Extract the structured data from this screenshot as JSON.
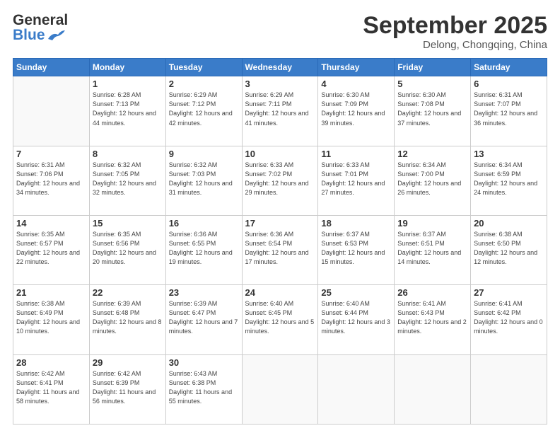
{
  "header": {
    "logo_general": "General",
    "logo_blue": "Blue",
    "month_title": "September 2025",
    "subtitle": "Delong, Chongqing, China"
  },
  "weekdays": [
    "Sunday",
    "Monday",
    "Tuesday",
    "Wednesday",
    "Thursday",
    "Friday",
    "Saturday"
  ],
  "weeks": [
    [
      {
        "day": "",
        "sunrise": "",
        "sunset": "",
        "daylight": ""
      },
      {
        "day": "1",
        "sunrise": "Sunrise: 6:28 AM",
        "sunset": "Sunset: 7:13 PM",
        "daylight": "Daylight: 12 hours and 44 minutes."
      },
      {
        "day": "2",
        "sunrise": "Sunrise: 6:29 AM",
        "sunset": "Sunset: 7:12 PM",
        "daylight": "Daylight: 12 hours and 42 minutes."
      },
      {
        "day": "3",
        "sunrise": "Sunrise: 6:29 AM",
        "sunset": "Sunset: 7:11 PM",
        "daylight": "Daylight: 12 hours and 41 minutes."
      },
      {
        "day": "4",
        "sunrise": "Sunrise: 6:30 AM",
        "sunset": "Sunset: 7:09 PM",
        "daylight": "Daylight: 12 hours and 39 minutes."
      },
      {
        "day": "5",
        "sunrise": "Sunrise: 6:30 AM",
        "sunset": "Sunset: 7:08 PM",
        "daylight": "Daylight: 12 hours and 37 minutes."
      },
      {
        "day": "6",
        "sunrise": "Sunrise: 6:31 AM",
        "sunset": "Sunset: 7:07 PM",
        "daylight": "Daylight: 12 hours and 36 minutes."
      }
    ],
    [
      {
        "day": "7",
        "sunrise": "Sunrise: 6:31 AM",
        "sunset": "Sunset: 7:06 PM",
        "daylight": "Daylight: 12 hours and 34 minutes."
      },
      {
        "day": "8",
        "sunrise": "Sunrise: 6:32 AM",
        "sunset": "Sunset: 7:05 PM",
        "daylight": "Daylight: 12 hours and 32 minutes."
      },
      {
        "day": "9",
        "sunrise": "Sunrise: 6:32 AM",
        "sunset": "Sunset: 7:03 PM",
        "daylight": "Daylight: 12 hours and 31 minutes."
      },
      {
        "day": "10",
        "sunrise": "Sunrise: 6:33 AM",
        "sunset": "Sunset: 7:02 PM",
        "daylight": "Daylight: 12 hours and 29 minutes."
      },
      {
        "day": "11",
        "sunrise": "Sunrise: 6:33 AM",
        "sunset": "Sunset: 7:01 PM",
        "daylight": "Daylight: 12 hours and 27 minutes."
      },
      {
        "day": "12",
        "sunrise": "Sunrise: 6:34 AM",
        "sunset": "Sunset: 7:00 PM",
        "daylight": "Daylight: 12 hours and 26 minutes."
      },
      {
        "day": "13",
        "sunrise": "Sunrise: 6:34 AM",
        "sunset": "Sunset: 6:59 PM",
        "daylight": "Daylight: 12 hours and 24 minutes."
      }
    ],
    [
      {
        "day": "14",
        "sunrise": "Sunrise: 6:35 AM",
        "sunset": "Sunset: 6:57 PM",
        "daylight": "Daylight: 12 hours and 22 minutes."
      },
      {
        "day": "15",
        "sunrise": "Sunrise: 6:35 AM",
        "sunset": "Sunset: 6:56 PM",
        "daylight": "Daylight: 12 hours and 20 minutes."
      },
      {
        "day": "16",
        "sunrise": "Sunrise: 6:36 AM",
        "sunset": "Sunset: 6:55 PM",
        "daylight": "Daylight: 12 hours and 19 minutes."
      },
      {
        "day": "17",
        "sunrise": "Sunrise: 6:36 AM",
        "sunset": "Sunset: 6:54 PM",
        "daylight": "Daylight: 12 hours and 17 minutes."
      },
      {
        "day": "18",
        "sunrise": "Sunrise: 6:37 AM",
        "sunset": "Sunset: 6:53 PM",
        "daylight": "Daylight: 12 hours and 15 minutes."
      },
      {
        "day": "19",
        "sunrise": "Sunrise: 6:37 AM",
        "sunset": "Sunset: 6:51 PM",
        "daylight": "Daylight: 12 hours and 14 minutes."
      },
      {
        "day": "20",
        "sunrise": "Sunrise: 6:38 AM",
        "sunset": "Sunset: 6:50 PM",
        "daylight": "Daylight: 12 hours and 12 minutes."
      }
    ],
    [
      {
        "day": "21",
        "sunrise": "Sunrise: 6:38 AM",
        "sunset": "Sunset: 6:49 PM",
        "daylight": "Daylight: 12 hours and 10 minutes."
      },
      {
        "day": "22",
        "sunrise": "Sunrise: 6:39 AM",
        "sunset": "Sunset: 6:48 PM",
        "daylight": "Daylight: 12 hours and 8 minutes."
      },
      {
        "day": "23",
        "sunrise": "Sunrise: 6:39 AM",
        "sunset": "Sunset: 6:47 PM",
        "daylight": "Daylight: 12 hours and 7 minutes."
      },
      {
        "day": "24",
        "sunrise": "Sunrise: 6:40 AM",
        "sunset": "Sunset: 6:45 PM",
        "daylight": "Daylight: 12 hours and 5 minutes."
      },
      {
        "day": "25",
        "sunrise": "Sunrise: 6:40 AM",
        "sunset": "Sunset: 6:44 PM",
        "daylight": "Daylight: 12 hours and 3 minutes."
      },
      {
        "day": "26",
        "sunrise": "Sunrise: 6:41 AM",
        "sunset": "Sunset: 6:43 PM",
        "daylight": "Daylight: 12 hours and 2 minutes."
      },
      {
        "day": "27",
        "sunrise": "Sunrise: 6:41 AM",
        "sunset": "Sunset: 6:42 PM",
        "daylight": "Daylight: 12 hours and 0 minutes."
      }
    ],
    [
      {
        "day": "28",
        "sunrise": "Sunrise: 6:42 AM",
        "sunset": "Sunset: 6:41 PM",
        "daylight": "Daylight: 11 hours and 58 minutes."
      },
      {
        "day": "29",
        "sunrise": "Sunrise: 6:42 AM",
        "sunset": "Sunset: 6:39 PM",
        "daylight": "Daylight: 11 hours and 56 minutes."
      },
      {
        "day": "30",
        "sunrise": "Sunrise: 6:43 AM",
        "sunset": "Sunset: 6:38 PM",
        "daylight": "Daylight: 11 hours and 55 minutes."
      },
      {
        "day": "",
        "sunrise": "",
        "sunset": "",
        "daylight": ""
      },
      {
        "day": "",
        "sunrise": "",
        "sunset": "",
        "daylight": ""
      },
      {
        "day": "",
        "sunrise": "",
        "sunset": "",
        "daylight": ""
      },
      {
        "day": "",
        "sunrise": "",
        "sunset": "",
        "daylight": ""
      }
    ]
  ]
}
